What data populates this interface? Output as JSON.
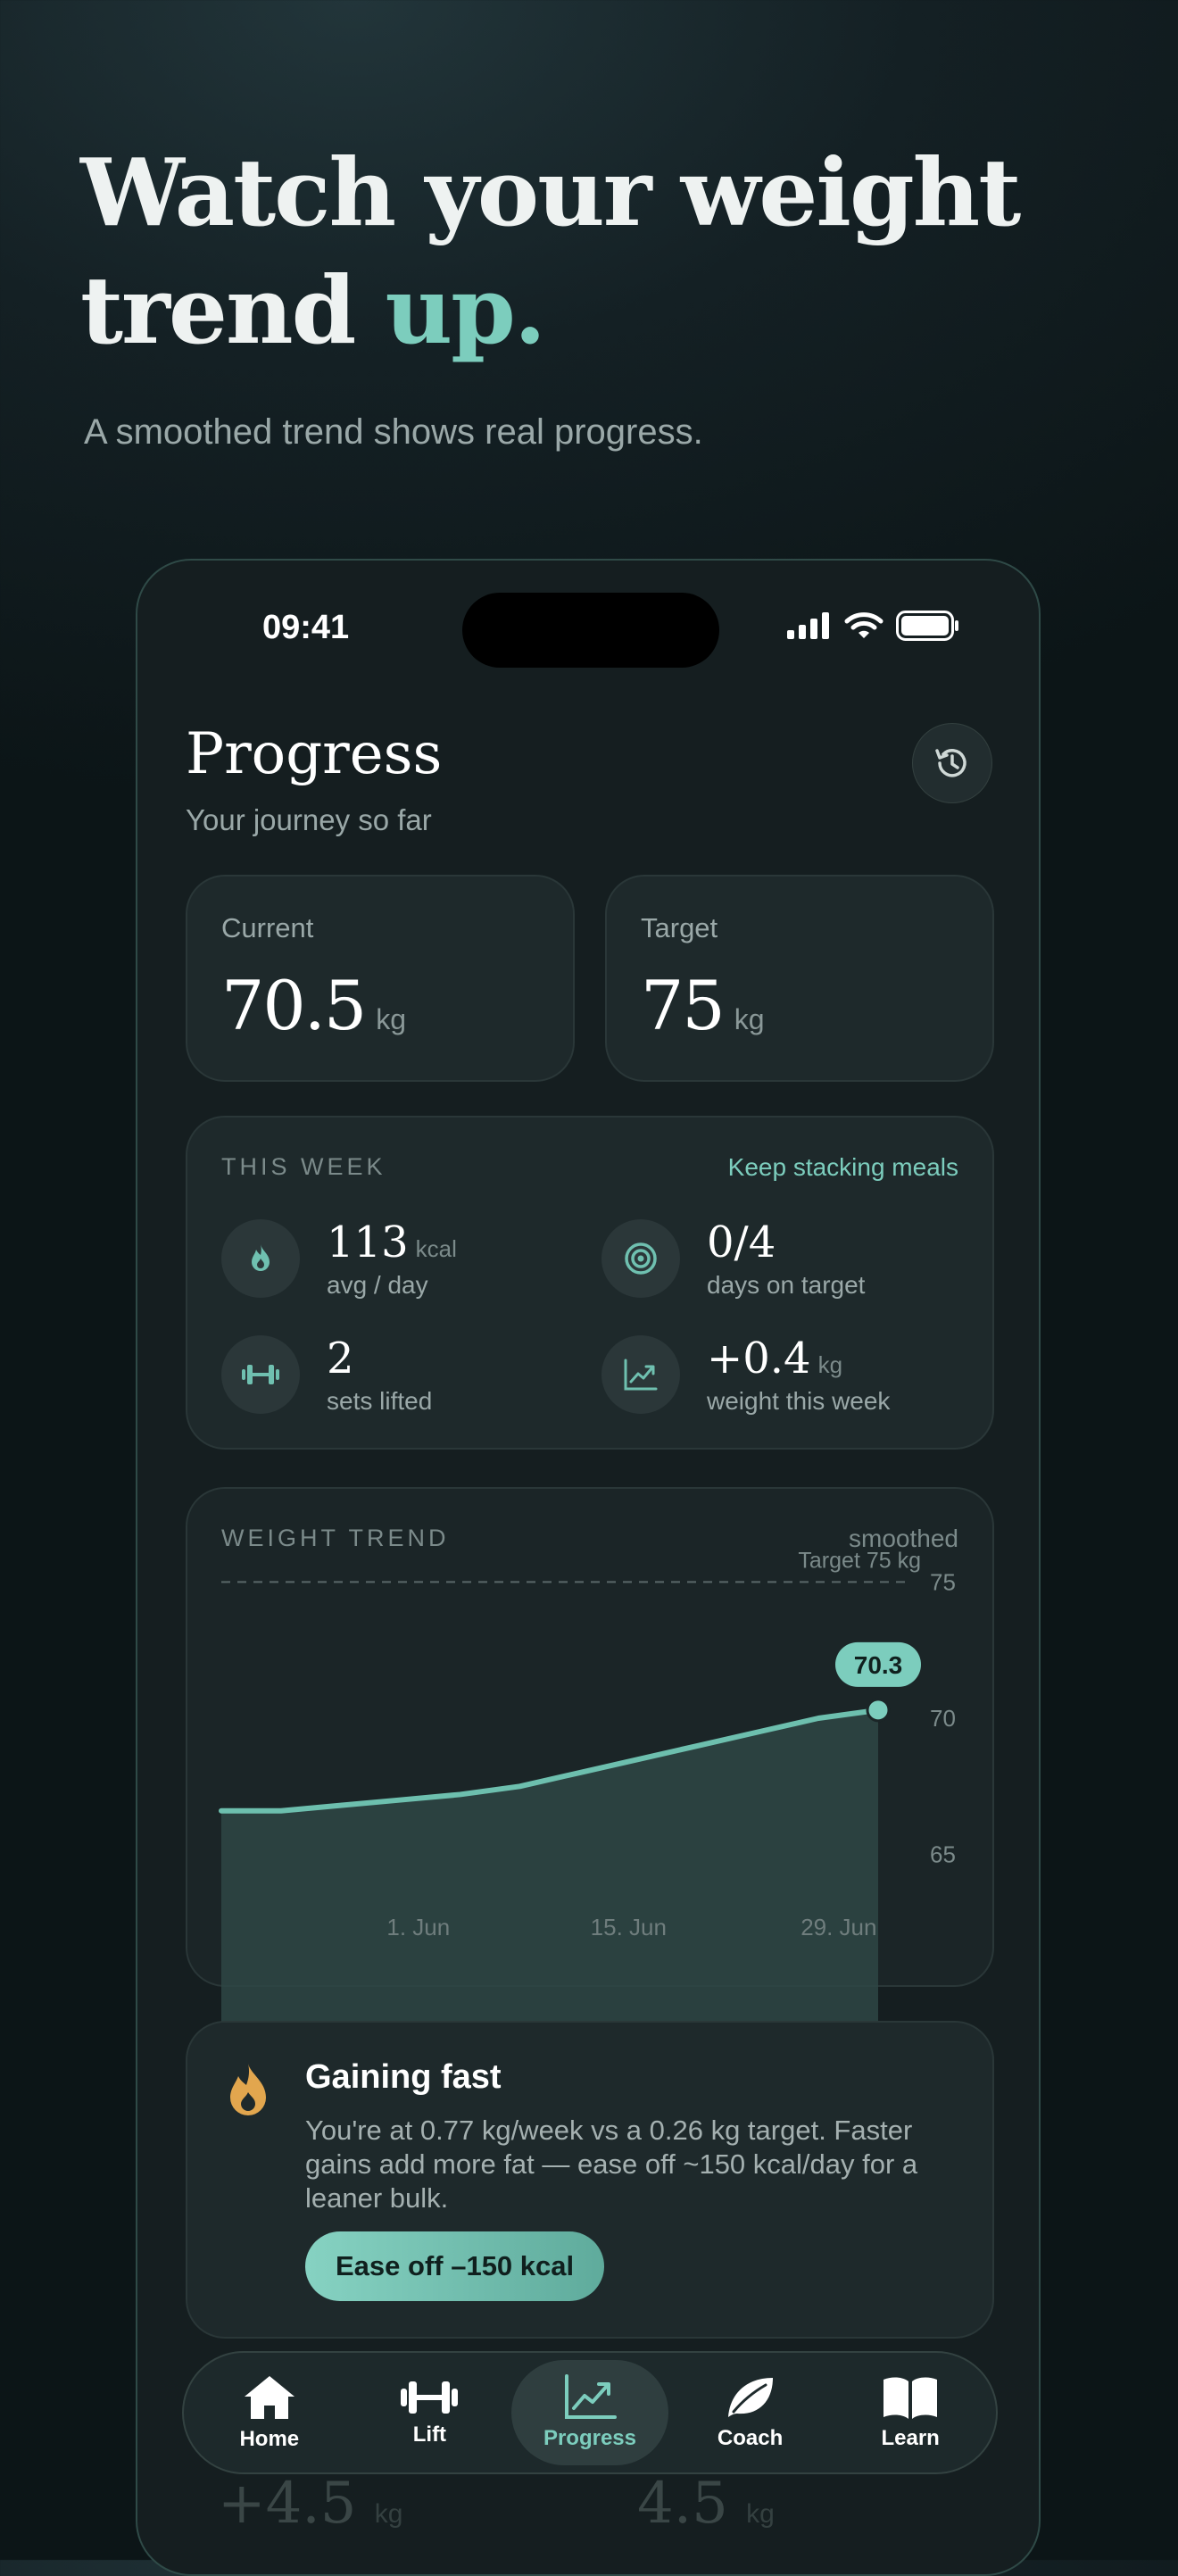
{
  "hero": {
    "title_line1": "Watch your weight",
    "title_line2_plain": "trend ",
    "title_line2_accent": "up.",
    "subtitle": "A smoothed trend shows real progress."
  },
  "status": {
    "time": "09:41"
  },
  "header": {
    "title": "Progress",
    "subtitle": "Your journey so far"
  },
  "stats": {
    "current": {
      "label": "Current",
      "value": "70.5",
      "unit": "kg"
    },
    "target": {
      "label": "Target",
      "value": "75",
      "unit": "kg"
    }
  },
  "week": {
    "label": "THIS WEEK",
    "cta": "Keep stacking meals",
    "items": [
      {
        "value": "113",
        "unit": "kcal",
        "label": "avg / day",
        "icon": "flame-icon"
      },
      {
        "value": "0/4",
        "unit": "",
        "label": "days on target",
        "icon": "target-icon"
      },
      {
        "value": "2",
        "unit": "",
        "label": "sets lifted",
        "icon": "dumbbell-icon"
      },
      {
        "value": "+0.4",
        "unit": "kg",
        "label": "weight this week",
        "icon": "trend-icon"
      }
    ]
  },
  "trend": {
    "label": "WEIGHT TREND",
    "mode": "smoothed",
    "target_label": "Target 75 kg",
    "current_badge": "70.3"
  },
  "chart_data": {
    "type": "area",
    "title": "WEIGHT TREND",
    "xlabel": "",
    "ylabel": "",
    "ylim": [
      64.2,
      75.8
    ],
    "yticks": [
      "75",
      "70",
      "65"
    ],
    "xticks": [
      "1. Jun",
      "15. Jun",
      "29. Jun"
    ],
    "target": 75,
    "series": [
      {
        "x": [
          "May 19",
          "May 22",
          "May 25",
          "May 28",
          "Jun 1",
          "Jun 5",
          "Jun 9",
          "Jun 13",
          "Jun 17",
          "Jun 21",
          "Jun 25",
          "Jun 29"
        ],
        "values": [
          66.6,
          66.6,
          66.8,
          67.0,
          67.2,
          67.5,
          68.0,
          68.5,
          69.0,
          69.5,
          70.0,
          70.3
        ]
      }
    ],
    "grid": false,
    "colors": {
      "line": "#6dbfae",
      "fill": "#2e4745",
      "target": "#5a6868"
    }
  },
  "alert": {
    "title": "Gaining fast",
    "body": "You're at 0.77 kg/week vs a 0.26 kg target. Faster gains add more fat — ease off ~150 kcal/day for a leaner bulk.",
    "button": "Ease off –150 kcal"
  },
  "peek": {
    "left_value": "+4.5",
    "left_unit": "kg",
    "right_value": "4.5",
    "right_unit": "kg"
  },
  "tabs": [
    {
      "label": "Home",
      "icon": "home-icon"
    },
    {
      "label": "Lift",
      "icon": "dumbbell-icon"
    },
    {
      "label": "Progress",
      "icon": "chart-icon",
      "active": true
    },
    {
      "label": "Coach",
      "icon": "leaf-icon"
    },
    {
      "label": "Learn",
      "icon": "book-icon"
    }
  ],
  "colors": {
    "accent": "#7ccdbd",
    "warning": "#e2a64e",
    "background": "#151e20"
  }
}
